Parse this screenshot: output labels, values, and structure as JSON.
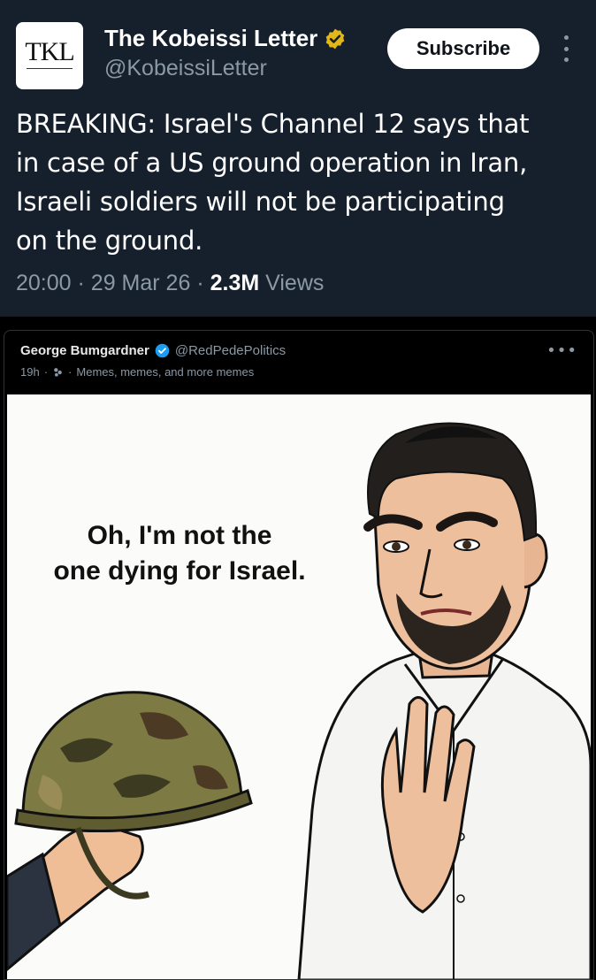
{
  "tweet": {
    "logo_text": "TKL",
    "author_name": "The Kobeissi Letter",
    "author_handle": "@KobeissiLetter",
    "subscribe_label": "Subscribe",
    "text_lines": [
      "BREAKING: Israel's Channel 12 says that",
      "in case of a US ground operation in Iran,",
      "Israeli soldiers will not be participating",
      "on the ground."
    ],
    "time": "20:00",
    "date": "29 Mar 26",
    "views_count": "2.3M",
    "views_label": "Views"
  },
  "post": {
    "author_name": "George Bumgardner",
    "author_handle": "@RedPedePolitics",
    "age": "19h",
    "community": "Memes, memes, and more memes",
    "more_icon": "more-horizontal-icon",
    "meme_caption_lines": [
      "Oh, I'm not the",
      "one dying for Israel."
    ]
  },
  "colors": {
    "card_bg": "#16202d",
    "muted_text": "#8b98a5",
    "gold_badge": "#e2b719",
    "blue_badge": "#1d9bf0"
  }
}
